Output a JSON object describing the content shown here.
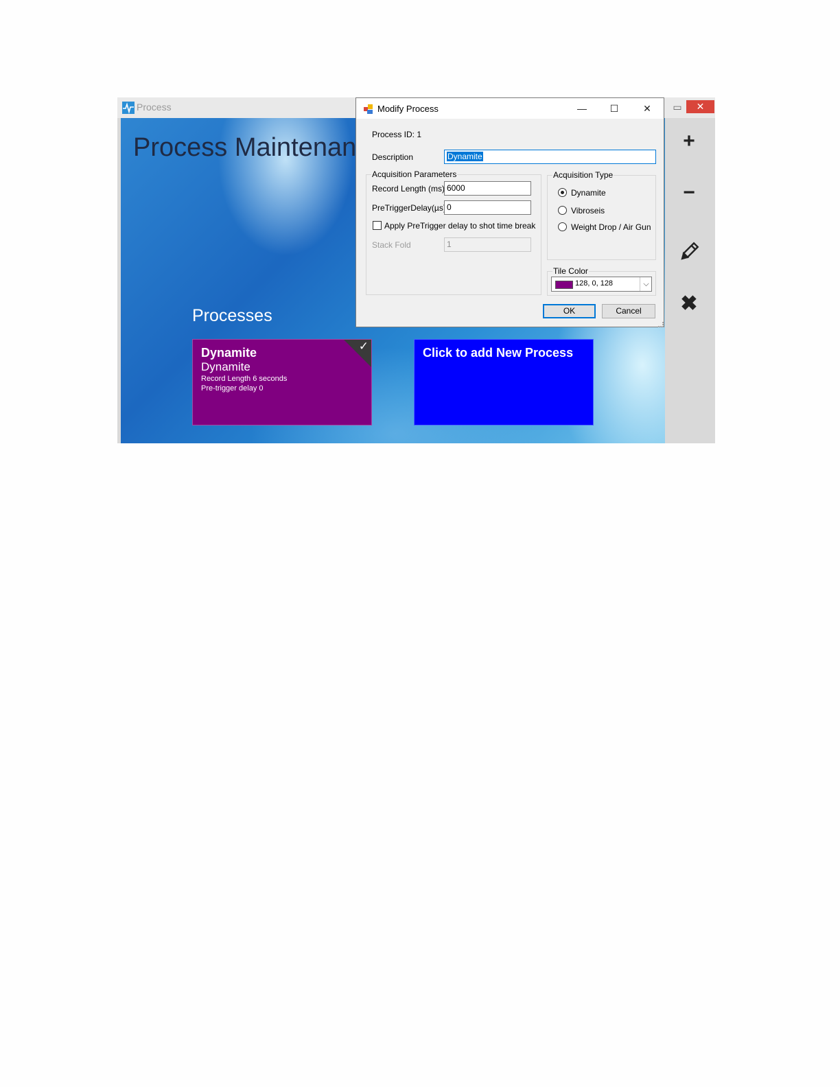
{
  "main_window": {
    "title": "Process",
    "page_title": "Process Maintenance",
    "processes_heading": "Processes",
    "controls": {
      "minimize": "▭",
      "close": "✕"
    }
  },
  "tiles": [
    {
      "title": "Dynamite",
      "subtitle": "Dynamite",
      "line1": "Record Length 6 seconds",
      "line2": "Pre-trigger delay 0",
      "color": "#800080",
      "selected": true
    },
    {
      "title": "Click to add New Process",
      "color": "#0000ff"
    }
  ],
  "toolbar": {
    "add_icon": "plus-icon",
    "remove_icon": "minus-icon",
    "edit_icon": "pencil-icon",
    "delete_icon": "x-icon"
  },
  "dialog": {
    "title": "Modify Process",
    "process_id": "Process ID: 1",
    "description_label": "Description",
    "description_value": "Dynamite",
    "acq_params_title": "Acquisition Parameters",
    "record_length_label": "Record Length (ms)",
    "record_length_value": "6000",
    "pretrigger_label": "PreTriggerDelay(µs)",
    "pretrigger_value": "0",
    "apply_pretrigger_label": "Apply PreTrigger delay to shot time break",
    "apply_pretrigger_checked": false,
    "stack_fold_label": "Stack Fold",
    "stack_fold_value": "1",
    "acq_type_title": "Acquisition Type",
    "acq_types": [
      {
        "label": "Dynamite",
        "selected": true
      },
      {
        "label": "Vibroseis",
        "selected": false
      },
      {
        "label": "Weight Drop / Air Gun",
        "selected": false
      }
    ],
    "tile_color_label": "Tile Color",
    "tile_color_value": "128, 0, 128",
    "tile_color_hex": "#800080",
    "ok_label": "OK",
    "cancel_label": "Cancel"
  }
}
